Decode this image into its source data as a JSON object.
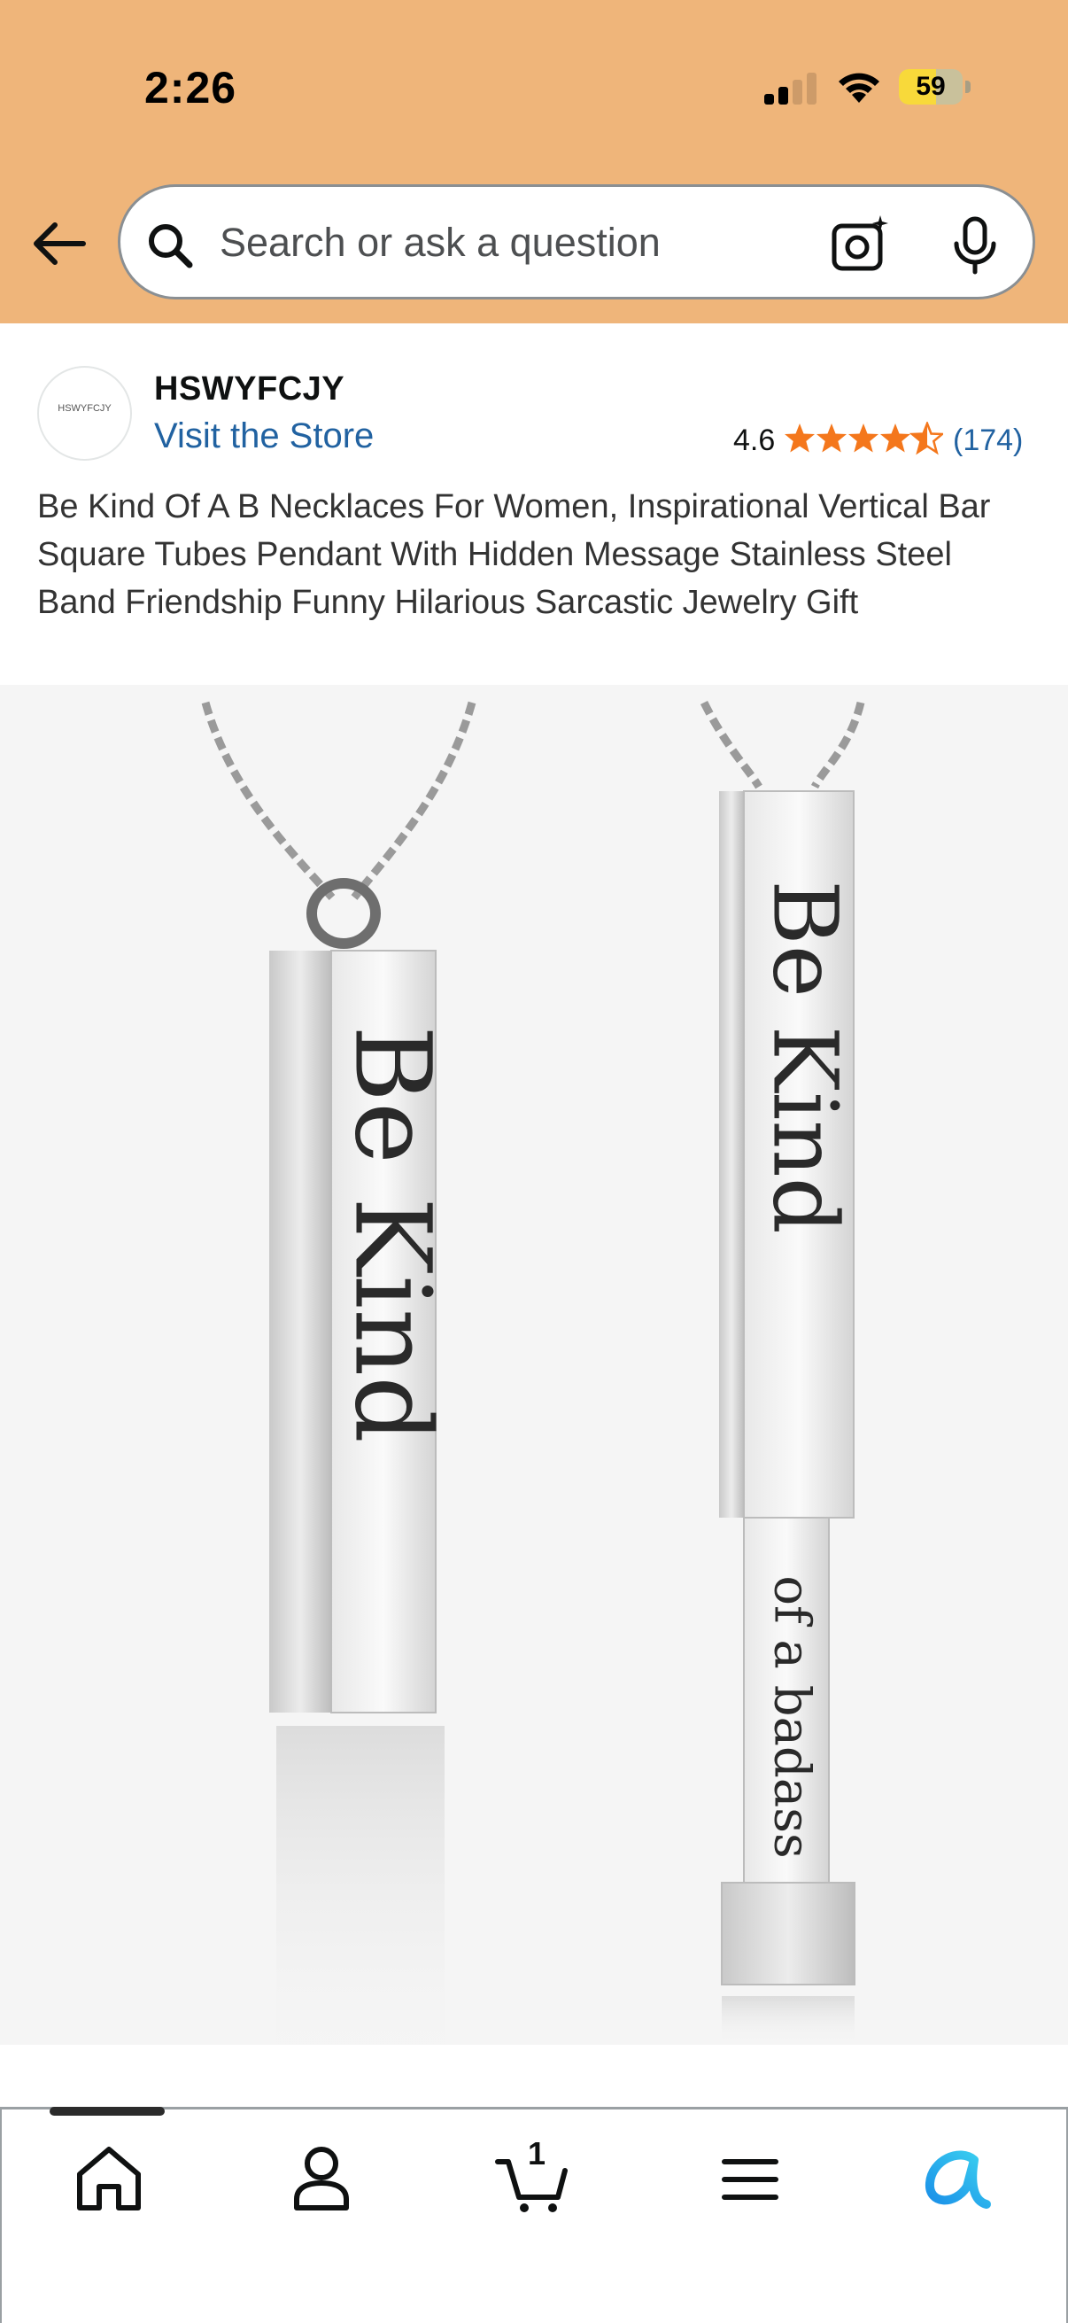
{
  "status_bar": {
    "time": "2:26",
    "battery": "59",
    "battery_level": 0.59
  },
  "search": {
    "placeholder": "Search or ask a question"
  },
  "icons": {
    "back": "arrow-left-icon",
    "search": "search-icon",
    "camera": "camera-lens-icon",
    "mic": "microphone-icon",
    "home": "home-icon",
    "account": "person-icon",
    "cart": "cart-icon",
    "menu": "hamburger-menu-icon",
    "rufus": "rufus-ai-icon"
  },
  "seller": {
    "name": "HSWYFCJY",
    "logo_text": "HSWYFCJY",
    "store_link": "Visit the Store"
  },
  "rating": {
    "value": "4.6",
    "stars": 4.5,
    "count": "(174)"
  },
  "product": {
    "title": "Be Kind Of A B Necklaces For Women, Inspirational Vertical Bar Square Tubes Pendant With Hidden Message Stainless Steel Band Friendship Funny Hilarious Sarcastic Jewelry Gift",
    "engraving_left": "Be Kind",
    "engraving_right_top": "Be Kind",
    "engraving_right_bottom": "of a badass"
  },
  "bottom_nav": {
    "cart_count": "1"
  },
  "colors": {
    "header_bg": "#efb57a",
    "link": "#2162a1",
    "star": "#f4771c",
    "rufus_blue": "#1a8fe8"
  }
}
